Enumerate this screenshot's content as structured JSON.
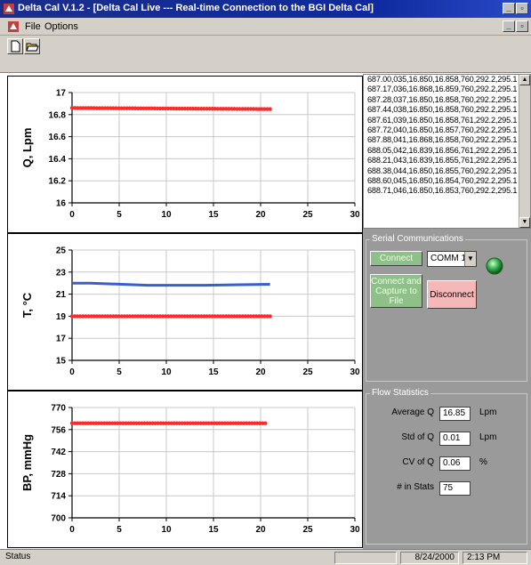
{
  "window": {
    "title": "Delta Cal V.1.2 - [Delta Cal Live --- Real-time Connection to the BGI Delta Cal]",
    "colors": {
      "titlebar": "#0f2a9e",
      "panel": "#9a9a9a",
      "face": "#d4d0c8",
      "series_red": "#ff2a2a",
      "series_blue": "#3a5fcd"
    }
  },
  "menu": {
    "file": "File",
    "options": "Options"
  },
  "toolbar": {
    "icons": [
      "new-document-icon",
      "open-folder-icon"
    ]
  },
  "charts": [
    {
      "ylabel": "Q, Lpm",
      "yticks": [
        "17",
        "16.8",
        "16.6",
        "16.4",
        "16.2",
        "16"
      ],
      "xticks": [
        "0",
        "5",
        "10",
        "15",
        "20",
        "25",
        "30"
      ]
    },
    {
      "ylabel": "T, °C",
      "yticks": [
        "25",
        "23",
        "21",
        "19",
        "17",
        "15"
      ],
      "xticks": [
        "0",
        "5",
        "10",
        "15",
        "20",
        "25",
        "30"
      ]
    },
    {
      "ylabel": "BP, mmHg",
      "yticks": [
        "770",
        "756",
        "742",
        "728",
        "714",
        "700"
      ],
      "xticks": [
        "0",
        "5",
        "10",
        "15",
        "20",
        "25",
        "30"
      ]
    }
  ],
  "chart_data": [
    {
      "type": "scatter",
      "ylabel": "Q, Lpm",
      "xlim": [
        0,
        30
      ],
      "ylim": [
        16,
        17
      ],
      "grid": true,
      "series": [
        {
          "x": [
            0,
            21
          ],
          "values": [
            16.86,
            16.85
          ],
          "color": "#ff2a2a"
        }
      ]
    },
    {
      "type": "line",
      "ylabel": "T, °C",
      "xlim": [
        0,
        30
      ],
      "ylim": [
        15,
        25
      ],
      "grid": true,
      "series": [
        {
          "x": [
            0,
            2,
            8,
            14,
            21
          ],
          "values": [
            22,
            22,
            21.8,
            21.8,
            21.9
          ],
          "color": "#3a5fcd",
          "style": "line"
        },
        {
          "x": [
            0,
            21
          ],
          "values": [
            19,
            19
          ],
          "color": "#ff2a2a",
          "style": "dots"
        }
      ]
    },
    {
      "type": "scatter",
      "ylabel": "BP, mmHg",
      "xlim": [
        0,
        30
      ],
      "ylim": [
        700,
        770
      ],
      "grid": true,
      "series": [
        {
          "x": [
            0,
            20.5
          ],
          "values": [
            760,
            760
          ],
          "color": "#ff2a2a"
        }
      ]
    }
  ],
  "data_lines": [
    "687.00,035,16.850,16.858,760,292.2,295.1",
    "687.17,036,16.868,16.859,760,292.2,295.1",
    "687.28,037,16.850,16.858,760,292.2,295.1",
    "687.44,038,16.850,16.858,760,292.2,295.1",
    "687.61,039,16.850,16.858,761,292.2,295.1",
    "687.72,040,16.850,16.857,760,292.2,295.1",
    "687.88,041,16.868,16.858,760,292.2,295.1",
    "688.05,042,16.839,16.856,761,292.2,295.1",
    "688.21,043,16.839,16.855,761,292.2,295.1",
    "688.38,044,16.850,16.855,760,292.2,295.1",
    "688.60,045,16.850,16.854,760,292.2,295.1",
    "688.71,046,16.850,16.853,760,292.2,295.1"
  ],
  "serial": {
    "group_title": "Serial Communications",
    "connect_label": "Connect",
    "port_value": "COMM 1",
    "capture_label_1": "Connect and",
    "capture_label_2": "Capture to File",
    "disconnect_label": "Disconnect",
    "status_led_color": "#2fa84a"
  },
  "flow": {
    "group_title": "Flow Statistics",
    "avg_label": "Average Q",
    "avg_value": "16.85",
    "avg_unit": "Lpm",
    "std_label": "Std of Q",
    "std_value": "0.01",
    "std_unit": "Lpm",
    "cv_label": "CV of Q",
    "cv_value": "0.06",
    "cv_unit": "%",
    "n_label": "# in Stats",
    "n_value": "75"
  },
  "status": {
    "text": "Status",
    "date": "8/24/2000",
    "time": "2:13 PM"
  }
}
